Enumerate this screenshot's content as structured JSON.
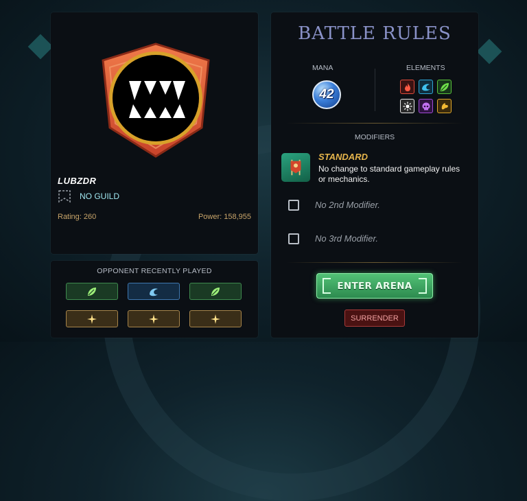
{
  "player": {
    "name": "LUBZDR",
    "guild": "NO GUILD",
    "rating": "Rating: 260",
    "power": "Power: 158,955"
  },
  "opponent": {
    "title": "OPPONENT RECENTLY PLAYED",
    "recent": [
      {
        "element": "earth",
        "color": "green",
        "icon": "leaf-icon"
      },
      {
        "element": "water",
        "color": "blue",
        "icon": "wave-icon"
      },
      {
        "element": "earth",
        "color": "green",
        "icon": "leaf-icon"
      },
      {
        "element": "life",
        "color": "gold",
        "icon": "sparkle-icon"
      },
      {
        "element": "life",
        "color": "gold",
        "icon": "sparkle-icon"
      },
      {
        "element": "life",
        "color": "gold",
        "icon": "sparkle-icon"
      }
    ]
  },
  "battle": {
    "title": "BATTLE RULES",
    "mana_label": "MANA",
    "mana": "42",
    "elements_label": "ELEMENTS",
    "elements": [
      {
        "name": "fire",
        "icon": "flame-icon",
        "color": "#e04a3a"
      },
      {
        "name": "water",
        "icon": "wave-icon",
        "color": "#2fa6d8"
      },
      {
        "name": "earth",
        "icon": "leaf-icon",
        "color": "#58c23a"
      },
      {
        "name": "life",
        "icon": "sun-icon",
        "color": "#e8e8e8"
      },
      {
        "name": "death",
        "icon": "skull-icon",
        "color": "#a34ad8"
      },
      {
        "name": "dragon",
        "icon": "dragon-icon",
        "color": "#e2a92a"
      }
    ],
    "modifiers_label": "MODIFIERS",
    "modifier_1": {
      "title": "STANDARD",
      "desc": "No change to standard gameplay rules or mechanics."
    },
    "modifier_2": "No 2nd Modifier.",
    "modifier_3": "No 3rd Modifier.",
    "enter_label": "ENTER ARENA",
    "surrender_label": "SURRENDER"
  },
  "colors": {
    "accent_gold": "#e6b54c",
    "enter_green": "#3ea862",
    "surrender_red": "#a93a3a"
  }
}
